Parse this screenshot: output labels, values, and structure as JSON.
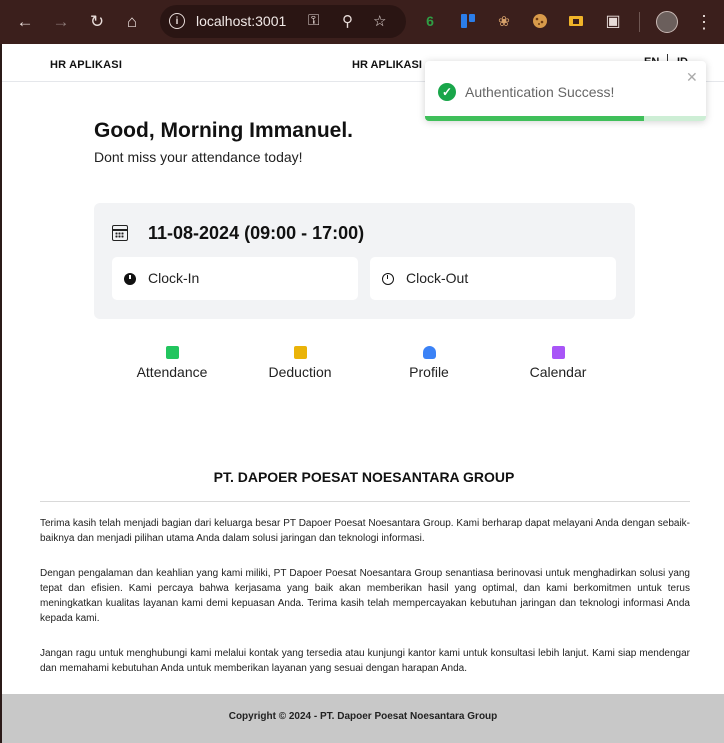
{
  "browser": {
    "url": "localhost:3001",
    "ext_counter": "6"
  },
  "topnav": {
    "brand_left": "HR APLIKASI",
    "brand_center": "HR APLIKASI",
    "lang_en": "EN",
    "lang_id": "ID"
  },
  "greeting": {
    "title": "Good, Morning Immanuel.",
    "subtitle": "Dont miss your attendance today!"
  },
  "attendance_card": {
    "date": "11-08-2024 (09:00 - 17:00)",
    "clock_in": "Clock-In",
    "clock_out": "Clock-Out"
  },
  "menu": [
    {
      "label": "Attendance",
      "icon": "list-icon",
      "color": "#22c55e"
    },
    {
      "label": "Deduction",
      "icon": "receipt-icon",
      "color": "#eab308"
    },
    {
      "label": "Profile",
      "icon": "user-icon",
      "color": "#3b82f6"
    },
    {
      "label": "Calendar",
      "icon": "calendar-icon",
      "color": "#a855f7"
    }
  ],
  "company": {
    "name": "PT. DAPOER POESAT NOESANTARA GROUP",
    "paragraphs": [
      "Terima kasih telah menjadi bagian dari keluarga besar PT Dapoer Poesat Noesantara Group. Kami berharap dapat melayani Anda dengan sebaik-baiknya dan menjadi pilihan utama Anda dalam solusi jaringan dan teknologi informasi.",
      "Dengan pengalaman dan keahlian yang kami miliki, PT Dapoer Poesat Noesantara Group senantiasa berinovasi untuk menghadirkan solusi yang tepat dan efisien. Kami percaya bahwa kerjasama yang baik akan memberikan hasil yang optimal, dan kami berkomitmen untuk terus meningkatkan kualitas layanan kami demi kepuasan Anda. Terima kasih telah mempercayakan kebutuhan jaringan dan teknologi informasi Anda kepada kami.",
      "Jangan ragu untuk menghubungi kami melalui kontak yang tersedia atau kunjungi kantor kami untuk konsultasi lebih lanjut. Kami siap mendengar dan memahami kebutuhan Anda untuk memberikan layanan yang sesuai dengan harapan Anda."
    ]
  },
  "footer": {
    "copyright": "Copyright © 2024 - PT. Dapoer Poesat Noesantara Group"
  },
  "toast": {
    "message": "Authentication Success!",
    "progress": 0.78,
    "accent": "#19a64a"
  }
}
